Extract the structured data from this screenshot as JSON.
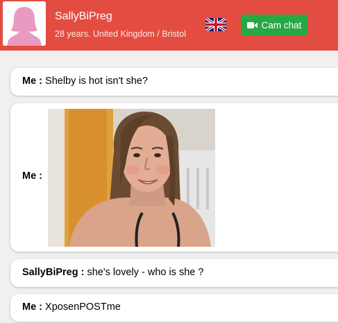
{
  "header": {
    "username": "SallyBiPreg",
    "info": "28 years. United Kingdom / Bristol",
    "flag_icon": "uk-flag-icon",
    "cam_button": {
      "label": "Cam chat",
      "icon": "video-camera-icon"
    },
    "colors": {
      "bar": "#e34c40",
      "cam_button": "#28a745"
    }
  },
  "messages": [
    {
      "sender": "Me :",
      "text": "Shelby is hot isn't she?"
    },
    {
      "sender": "Me :",
      "text": "",
      "image": "photo of a young woman with long wet hair"
    },
    {
      "sender": "SallyBiPreg :",
      "text": "she's lovely - who is she ?"
    },
    {
      "sender": "Me :",
      "text": "XposenPOSTme"
    }
  ]
}
